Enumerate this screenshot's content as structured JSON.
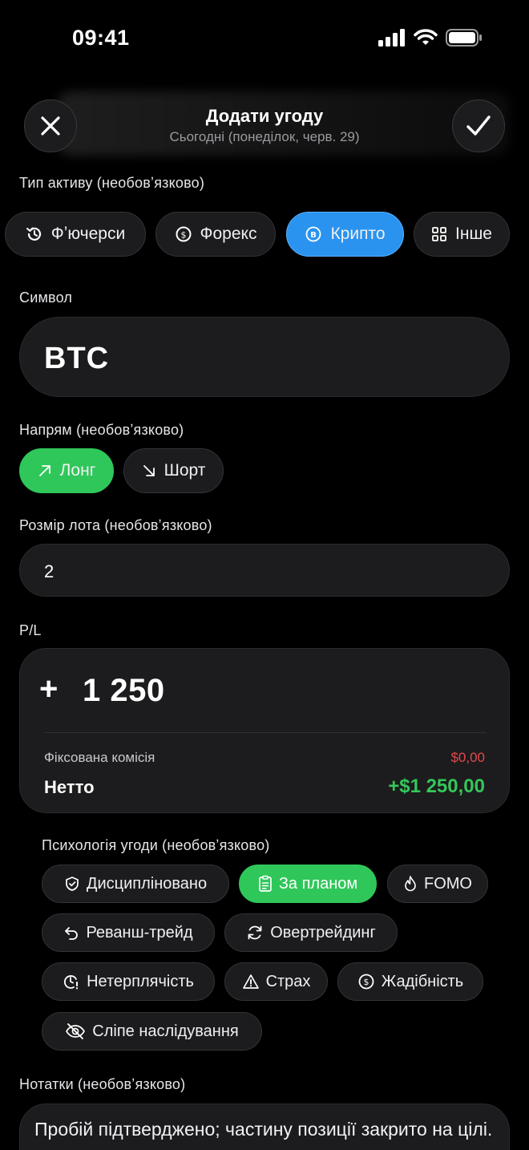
{
  "status_bar": {
    "time": "09:41"
  },
  "header": {
    "title": "Додати угоду",
    "subtitle": "Сьогодні (понеділок, черв. 29)",
    "close_icon": "close-icon",
    "confirm_icon": "checkmark-icon"
  },
  "asset_type": {
    "label": "Тип активу (необовʼязково)",
    "options": [
      {
        "label": "Фʼючерси",
        "icon": "history-icon",
        "selected": false
      },
      {
        "label": "Форекс",
        "icon": "currency-exchange-icon",
        "selected": false
      },
      {
        "label": "Крипто",
        "icon": "bitcoin-icon",
        "selected": true
      },
      {
        "label": "Інше",
        "icon": "grid-icon",
        "selected": false
      }
    ]
  },
  "symbol": {
    "label": "Символ",
    "value": "BTC"
  },
  "direction": {
    "label": "Напрям (необовʼязково)",
    "options": [
      {
        "label": "Лонг",
        "icon": "arrow-up-right-icon",
        "selected": true
      },
      {
        "label": "Шорт",
        "icon": "arrow-down-right-icon",
        "selected": false
      }
    ]
  },
  "lot_size": {
    "label": "Розмір лота (необовʼязково)",
    "value": "2"
  },
  "pl": {
    "label": "P/L",
    "sign": "+",
    "amount": "1 250",
    "fee_label": "Фіксована комісія",
    "fee_value": "$0,00",
    "net_label": "Нетто",
    "net_value": "+$1 250,00"
  },
  "psychology": {
    "label": "Психологія угоди (необовʼязково)",
    "tags": [
      {
        "label": "Дисципліновано",
        "icon": "shield-check-icon",
        "selected": false
      },
      {
        "label": "За планом",
        "icon": "clipboard-icon",
        "selected": true
      },
      {
        "label": "FOMO",
        "icon": "flame-icon",
        "selected": false
      },
      {
        "label": "Реванш-трейд",
        "icon": "undo-icon",
        "selected": false
      },
      {
        "label": "Овертрейдинг",
        "icon": "refresh-icon",
        "selected": false
      },
      {
        "label": "Нетерплячість",
        "icon": "clock-alert-icon",
        "selected": false
      },
      {
        "label": "Страх",
        "icon": "warning-icon",
        "selected": false
      },
      {
        "label": "Жадібність",
        "icon": "dollar-icon",
        "selected": false
      },
      {
        "label": "Сліпе наслідування",
        "icon": "eye-off-icon",
        "selected": false
      }
    ]
  },
  "notes": {
    "label": "Нотатки (необовʼязково)",
    "value": "Пробій підтверджено; частину позиції закрито на цілі."
  },
  "colors": {
    "background": "#000000",
    "card": "#1c1c1e",
    "accent_blue": "#2a93ef",
    "accent_green": "#2fc75a",
    "loss_red": "#e5484d",
    "profit_green": "#34c759"
  }
}
